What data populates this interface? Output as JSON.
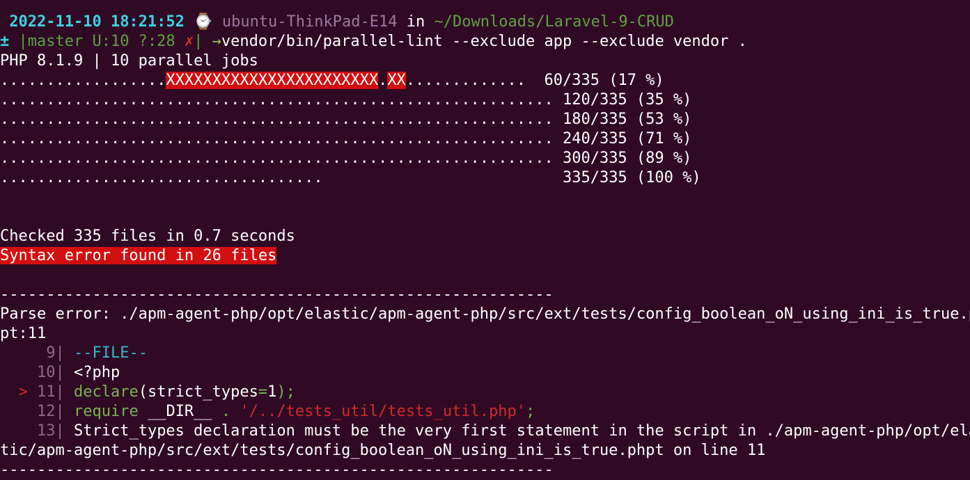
{
  "prompt": {
    "datetime": "2022-11-10 18:21:52",
    "clock_icon": "watch-icon",
    "host": "ubuntu-ThinkPad-E14",
    "in_word": "in",
    "cwd": "~/Downloads/Laravel-9-CRUD",
    "pm_symbol": "±",
    "git_status": "|master U:10 ?:28 ",
    "x_mark": "✗",
    "bar": "|",
    "arrow": " →",
    "command": "vendor/bin/parallel-lint --exclude app --exclude vendor ."
  },
  "output": {
    "php_info": "PHP 8.1.9 | 10 parallel jobs",
    "progress": [
      {
        "dots_before": "..................",
        "errors1": "XXXXXXXXXXXXXXXXXXXXXXX",
        "dot_mid": ".",
        "errors2": "XX",
        "dots_after": ".............",
        "counter": "  60/335 (17 %)"
      },
      {
        "dots": "............................................................",
        "counter": " 120/335 (35 %)"
      },
      {
        "dots": "............................................................",
        "counter": " 180/335 (53 %)"
      },
      {
        "dots": "............................................................",
        "counter": " 240/335 (71 %)"
      },
      {
        "dots": "............................................................",
        "counter": " 300/335 (89 %)"
      },
      {
        "dots": "...................................                         ",
        "counter": " 335/335 (100 %)"
      }
    ],
    "checked": "Checked 335 files in 0.7 seconds",
    "syntax_error": "Syntax error found in 26 files",
    "separator": "------------------------------------------------------------",
    "parse_error_1": "Parse error: ./apm-agent-php/opt/elastic/apm-agent-php/src/ext/tests/config_boolean_oN_using_ini_is_true.ph",
    "parse_error_2": "pt:11",
    "code": {
      "l9_num": "     9",
      "l9_sep": "| ",
      "l9_text": "--FILE--",
      "l10_num": "    10",
      "l10_sep": "| ",
      "l10_text": "<?php",
      "l11_marker": "  > ",
      "l11_num": "11",
      "l11_sep": "| ",
      "l11_kw": "declare",
      "l11_p1": "(",
      "l11_ident": "strict_types",
      "l11_eq": "=",
      "l11_val": "1",
      "l11_end": ");",
      "l12_num": "    12",
      "l12_sep": "| ",
      "l12_kw": "require",
      "l12_sp": " ",
      "l12_dir": "__DIR__",
      "l12_dot": " . ",
      "l12_str": "'/../tests_util/tests_util.php'",
      "l12_end": ";",
      "l13_num": "    13",
      "l13_sep": "| ",
      "l13_text": "Strict_types declaration must be the very first statement in the script in ./apm-agent-php/opt/elas",
      "l13_wrap": "tic/apm-agent-php/src/ext/tests/config_boolean_oN_using_ini_is_true.phpt on line 11"
    },
    "separator2": "------------------------------------------------------------"
  },
  "colors": {
    "background": "#300a24",
    "error_bg": "#d20f10",
    "cyan": "#2ec4d1",
    "green": "#5fa042"
  }
}
